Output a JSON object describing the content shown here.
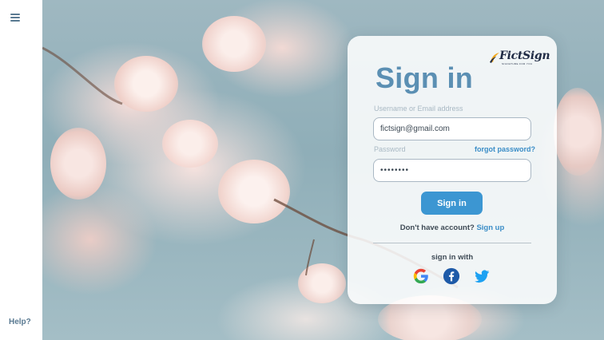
{
  "sidebar": {
    "menu_icon": "hamburger-menu-icon",
    "help_label": "Help?"
  },
  "logo": {
    "brand": "FictSign",
    "tagline": "SIGNATURE FOR YOU"
  },
  "signin": {
    "title": "Sign in",
    "username_label": "Username or Email address",
    "username_value": "fictsign@gmail.com",
    "password_label": "Password",
    "password_value": "••••••••",
    "forgot_label": "forgot password?",
    "submit_label": "Sign in",
    "no_account_text": "Don't have account?",
    "signup_label": "Sign up",
    "social_label": "sign in with",
    "social_icons": [
      "google-icon",
      "facebook-icon",
      "twitter-icon"
    ]
  },
  "colors": {
    "accent": "#3c96d2",
    "title": "#5b8fb3",
    "link": "#3a8dc7",
    "facebook": "#1e5aa8",
    "twitter": "#1da1f2"
  }
}
